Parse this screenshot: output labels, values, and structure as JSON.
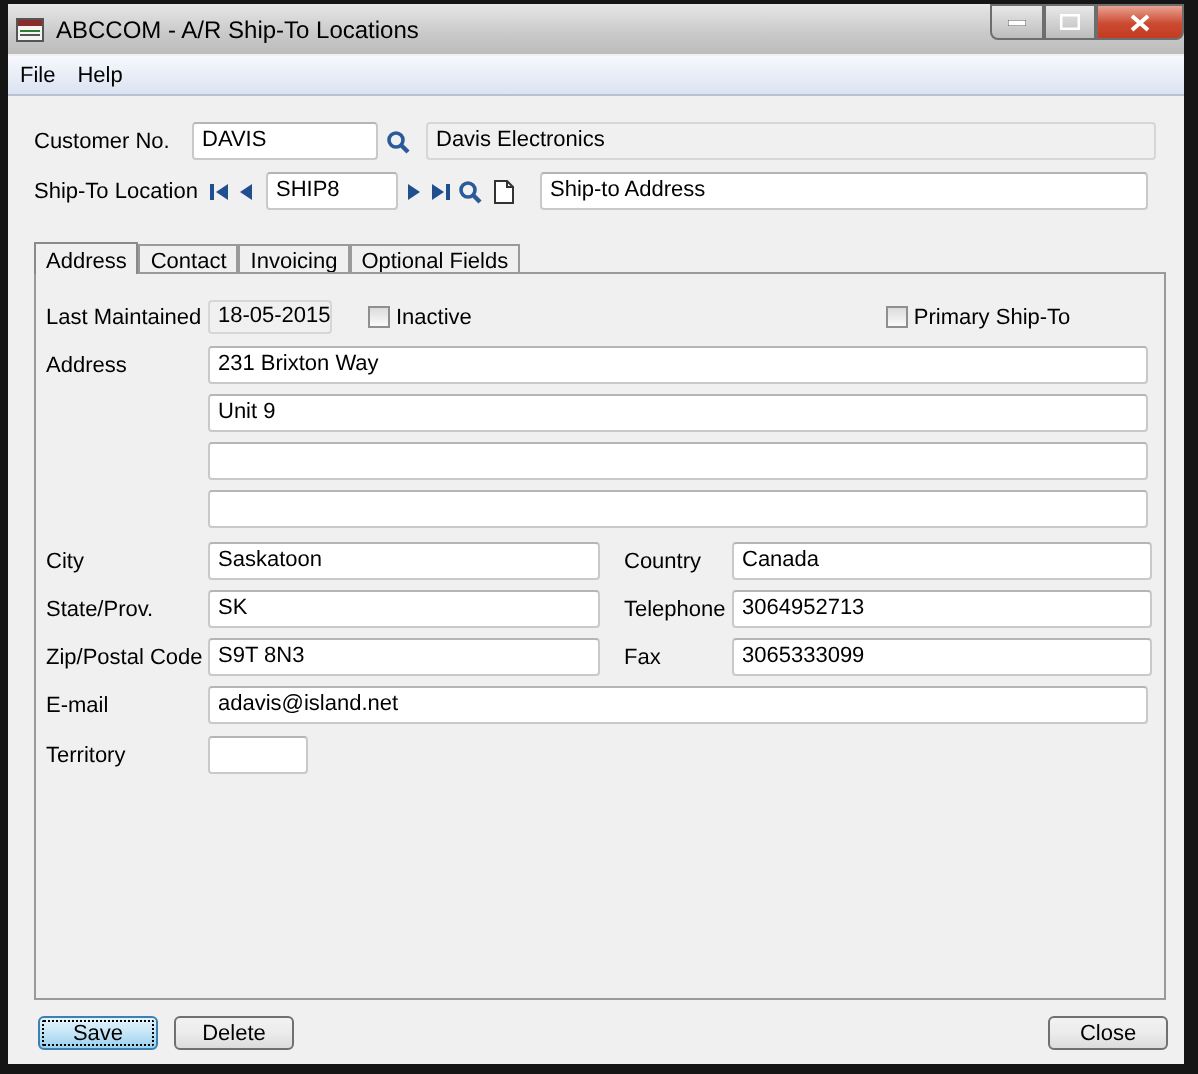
{
  "window": {
    "title": "ABCCOM - A/R Ship-To Locations"
  },
  "menu": [
    {
      "label": "File"
    },
    {
      "label": "Help"
    }
  ],
  "customer": {
    "label": "Customer No.",
    "value": "DAVIS",
    "description": "Davis Electronics"
  },
  "ship_to": {
    "label": "Ship-To Location",
    "value": "SHIP8",
    "description": "Ship-to Address"
  },
  "tabs": [
    {
      "label": "Address",
      "selected": true
    },
    {
      "label": "Contact",
      "selected": false
    },
    {
      "label": "Invoicing",
      "selected": false
    },
    {
      "label": "Optional Fields",
      "selected": false
    }
  ],
  "last_maintained": {
    "label": "Last Maintained",
    "value": "18-05-2015"
  },
  "checkboxes": [
    {
      "label": "Inactive",
      "checked": false
    },
    {
      "label": "Primary Ship-To",
      "checked": false
    }
  ],
  "address": {
    "label": "Address",
    "lines": [
      "231 Brixton Way",
      "Unit 9"
    ]
  },
  "pairs": [
    [
      {
        "label": "City",
        "value": "Saskatoon"
      },
      {
        "label": "Country",
        "value": "Canada"
      }
    ],
    [
      {
        "label": "State/Prov.",
        "value": "SK"
      },
      {
        "label": "Telephone",
        "value": "3064952713"
      }
    ],
    [
      {
        "label": "Zip/Postal Code",
        "value": "S9T 8N3"
      },
      {
        "label": "Fax",
        "value": "3065333099"
      }
    ]
  ],
  "email": {
    "label": "E-mail",
    "value": "adavis@island.net"
  },
  "territory": {
    "label": "Territory"
  },
  "buttons_left": [
    {
      "label": "Save",
      "focused": true
    },
    {
      "label": "Delete",
      "focused": false
    }
  ],
  "buttons_right": [
    {
      "label": "Close",
      "focused": false
    }
  ]
}
